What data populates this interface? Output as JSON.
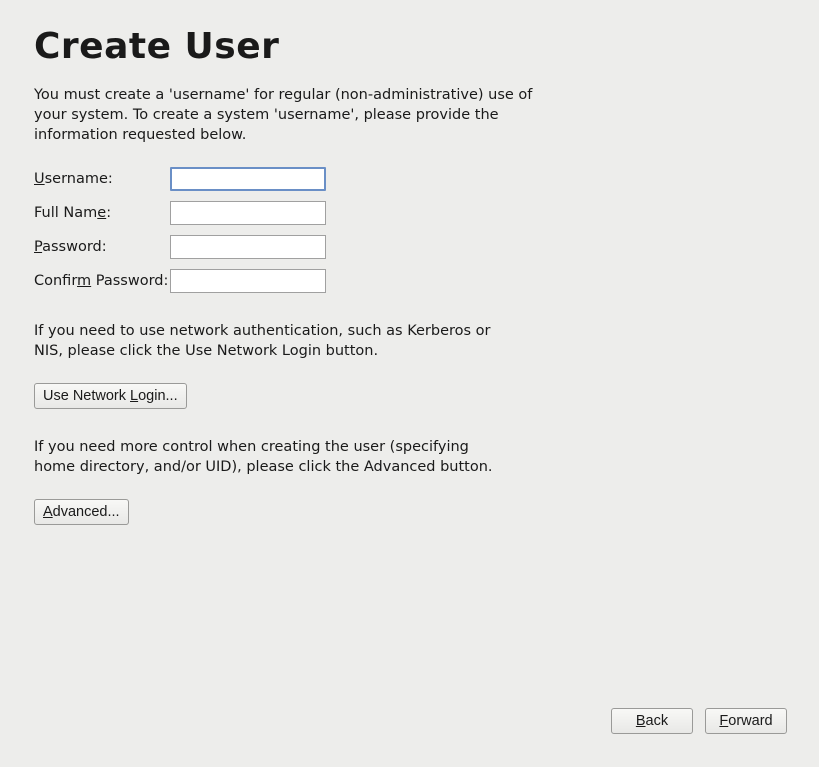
{
  "title": "Create User",
  "intro": "You must create a 'username' for regular (non-administrative) use of your system.  To create a system 'username', please provide the information requested below.",
  "form": {
    "username": {
      "label_pre": "U",
      "label_post": "sername:",
      "value": ""
    },
    "fullname": {
      "label_pre": "Full Nam",
      "label_mid": "e",
      "label_post": ":",
      "value": ""
    },
    "password": {
      "label_pre": "P",
      "label_post": "assword:",
      "value": ""
    },
    "confirm": {
      "label_pre": "Confir",
      "label_mid": "m",
      "label_post": " Password:",
      "value": ""
    }
  },
  "network_text": "If you need to use network authentication, such as Kerberos or NIS, please click the Use Network Login button.",
  "network_btn_pre": "Use Network ",
  "network_btn_mid": "L",
  "network_btn_post": "ogin...",
  "advanced_text": "If you need more control when creating the user (specifying home directory, and/or UID), please click the Advanced button.",
  "advanced_btn_pre": "A",
  "advanced_btn_post": "dvanced...",
  "back_btn_pre": "B",
  "back_btn_post": "ack",
  "forward_btn_pre": "F",
  "forward_btn_post": "orward"
}
